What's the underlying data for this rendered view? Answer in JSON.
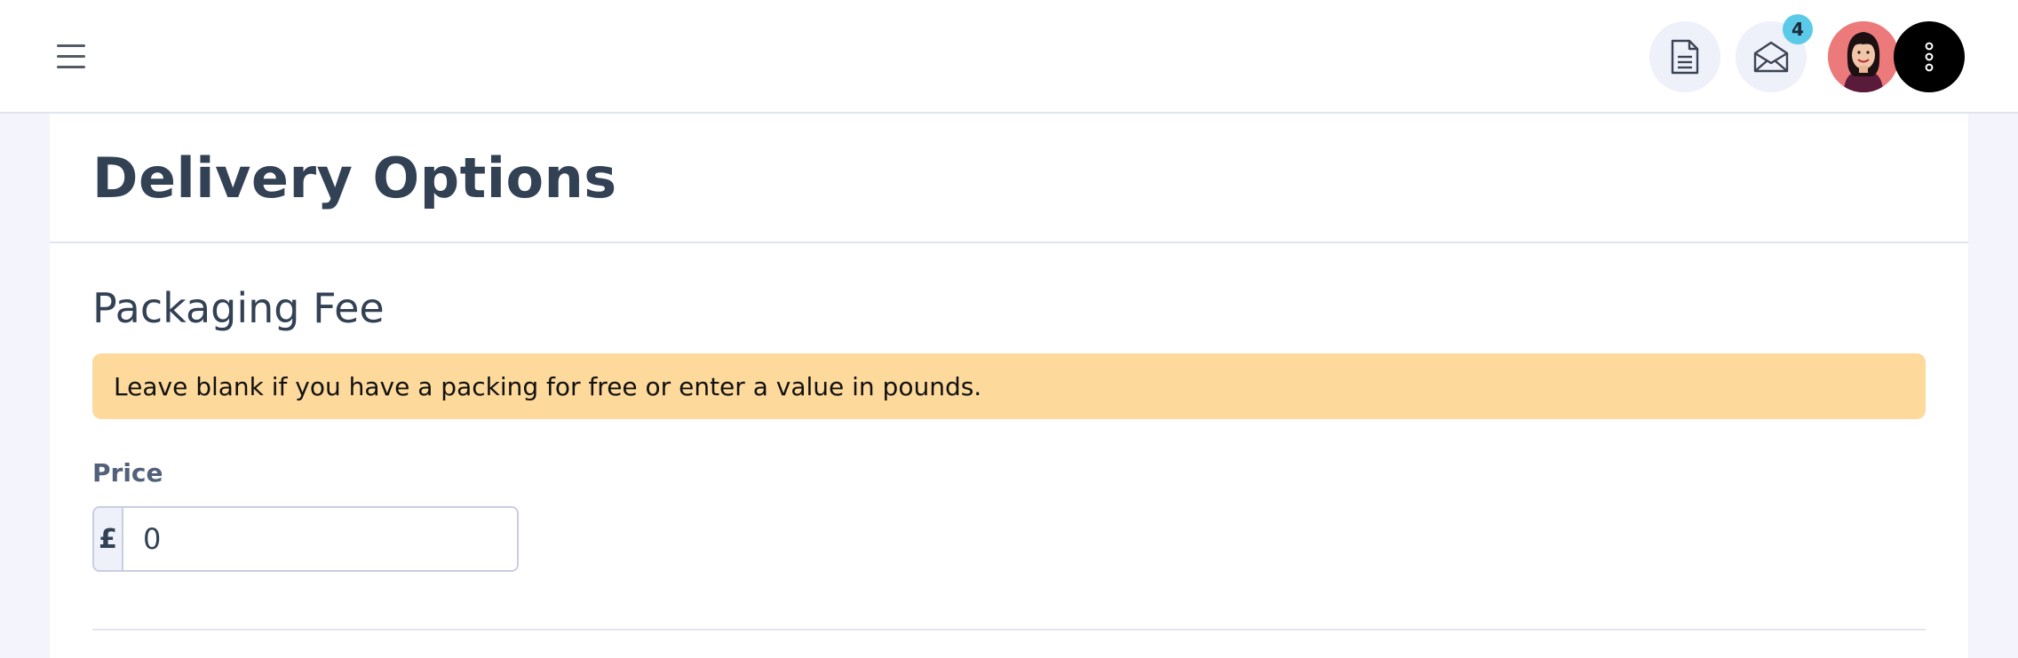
{
  "header": {
    "menu_icon": "hamburger-icon",
    "document_icon": "document-icon",
    "mail_icon": "envelope-open-icon",
    "notification_count": "4",
    "more_icon": "vertical-dots-icon"
  },
  "page": {
    "title": "Delivery Options"
  },
  "packaging": {
    "section_title": "Packaging Fee",
    "alert_text": "Leave blank if you have a packing for free or enter a value in pounds.",
    "price_label": "Price",
    "currency_symbol": "£",
    "price_value": "0"
  },
  "colors": {
    "alert_background": "#fdd99b",
    "badge": "#5bc9e8",
    "avatar_background": "#ec7a7a",
    "page_background": "#f3f4fc"
  }
}
